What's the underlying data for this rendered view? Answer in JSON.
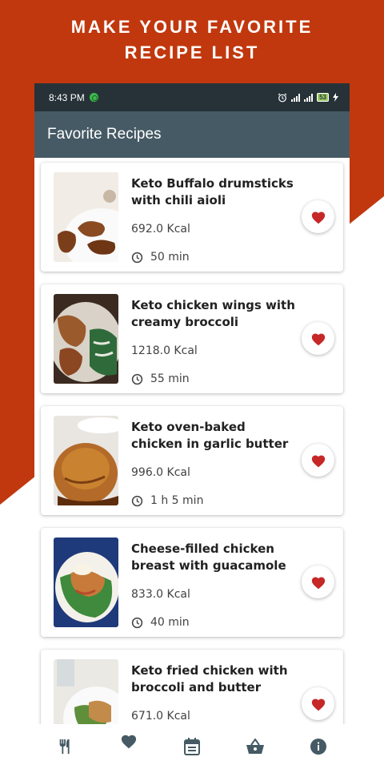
{
  "promo": {
    "headline_line1": "MAKE YOUR FAVORITE",
    "headline_line2": "RECIPE LIST",
    "brand_color": "#C1380E"
  },
  "statusbar": {
    "time": "8:43 PM",
    "battery": "53"
  },
  "appbar": {
    "title": "Favorite Recipes",
    "color": "#455A64"
  },
  "recipes": [
    {
      "title": "Keto Buffalo drumsticks with chili aioli",
      "kcal": "692.0 Kcal",
      "time": "50 min",
      "favorite": true
    },
    {
      "title": "Keto chicken wings with creamy broccoli",
      "kcal": "1218.0 Kcal",
      "time": "55 min",
      "favorite": true
    },
    {
      "title": "Keto oven-baked chicken in garlic butter",
      "kcal": "996.0 Kcal",
      "time": "1 h 5 min",
      "favorite": true
    },
    {
      "title": "Cheese-filled chicken breast with guacamole",
      "kcal": "833.0 Kcal",
      "time": "40 min",
      "favorite": true
    },
    {
      "title": "Keto fried chicken with broccoli and butter",
      "kcal": "671.0 Kcal",
      "time": "",
      "favorite": true
    }
  ],
  "bottom_nav": [
    {
      "icon": "fork-knife-icon",
      "active": false
    },
    {
      "icon": "heart-icon",
      "active": true
    },
    {
      "icon": "calendar-icon",
      "active": false
    },
    {
      "icon": "basket-icon",
      "active": false
    },
    {
      "icon": "info-icon",
      "active": false
    }
  ],
  "colors": {
    "heart": "#C62828",
    "nav_icon": "#455A64"
  }
}
